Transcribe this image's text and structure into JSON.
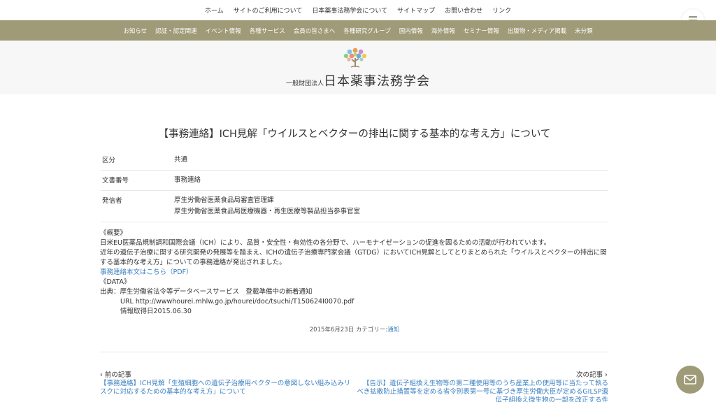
{
  "top_nav": [
    "ホーム",
    "サイトのご利用について",
    "日本薬事法務学会について",
    "サイトマップ",
    "お問い合わせ",
    "リンク"
  ],
  "main_nav": [
    "お知らせ",
    "認証・認定関連",
    "イベント情報",
    "各種サービス",
    "会員の皆さまへ",
    "各種研究グループ",
    "国内情報",
    "海外情報",
    "セミナー情報",
    "出版物・メディア掲載",
    "未分類"
  ],
  "brand": {
    "prefix": "一般財団法人",
    "name": "日本薬事法務学会"
  },
  "article": {
    "title": "【事務連絡】ICH見解「ウイルスとベクターの排出に関する基本的な考え方」について",
    "meta": {
      "category_label": "区分",
      "category_value": "共通",
      "docno_label": "文書番号",
      "docno_value": "事務連絡",
      "issuer_label": "発信者",
      "issuer_line1": "厚生労働省医薬食品局審査管理課",
      "issuer_line2": "厚生労働省医薬食品局医療機器・再生医療等製品担当参事官室"
    },
    "summary_heading": "《概要》",
    "summary_p1": "日米EU医薬品規制調和国際会議（ICH）により、品質・安全性・有効性の各分野で、ハーモナイゼーションの促進を図るための活動が行われています。",
    "summary_p2": "近年の遺伝子治療に関する研究開発の発展等を踏まえ、ICHの遺伝子治療専門家会議（GTDG）においてICH見解としてとりまとめられた「ウイルスとベクターの排出に関する基本的な考え方」についての事務連絡が発出されました。",
    "pdf_link": "事務連絡本文はこちら（PDF）",
    "data_heading": "《DATA》",
    "data_source": "出典：厚生労働省法令等データベースサービス　登載準備中の新着通知",
    "data_url": "URL http://wwwhourei.mhlw.go.jp/hourei/doc/tsuchi/T150624I0070.pdf",
    "data_date": "情報取得日2015.06.30",
    "posted_date": "2015年6月23日 カテゴリー:",
    "posted_category": "通知"
  },
  "pagination": {
    "prev_label": "‹ 前の記事",
    "next_label": "次の記事 ›",
    "prev_title": "【事務連絡】ICH見解「生殖細胞への遺伝子治療用ベクターの意図しない組み込みリスクに対応するための基本的な考え方」について",
    "next_title": "【告示】遺伝子組換え生物等の第二種使用等のうち産業上の使用等に当たって執るべき拡散防止措置等を定める省令別表第一号に基づき厚生労働大臣が定めるGILSP遺伝子組換え微生物の一部を改正する件"
  },
  "colors": {
    "accent": "#9f9a77",
    "link": "#3a7fc0"
  },
  "icons": {
    "menu": "hamburger-icon",
    "mail": "mail-icon",
    "logo": "tree-logo-icon"
  }
}
